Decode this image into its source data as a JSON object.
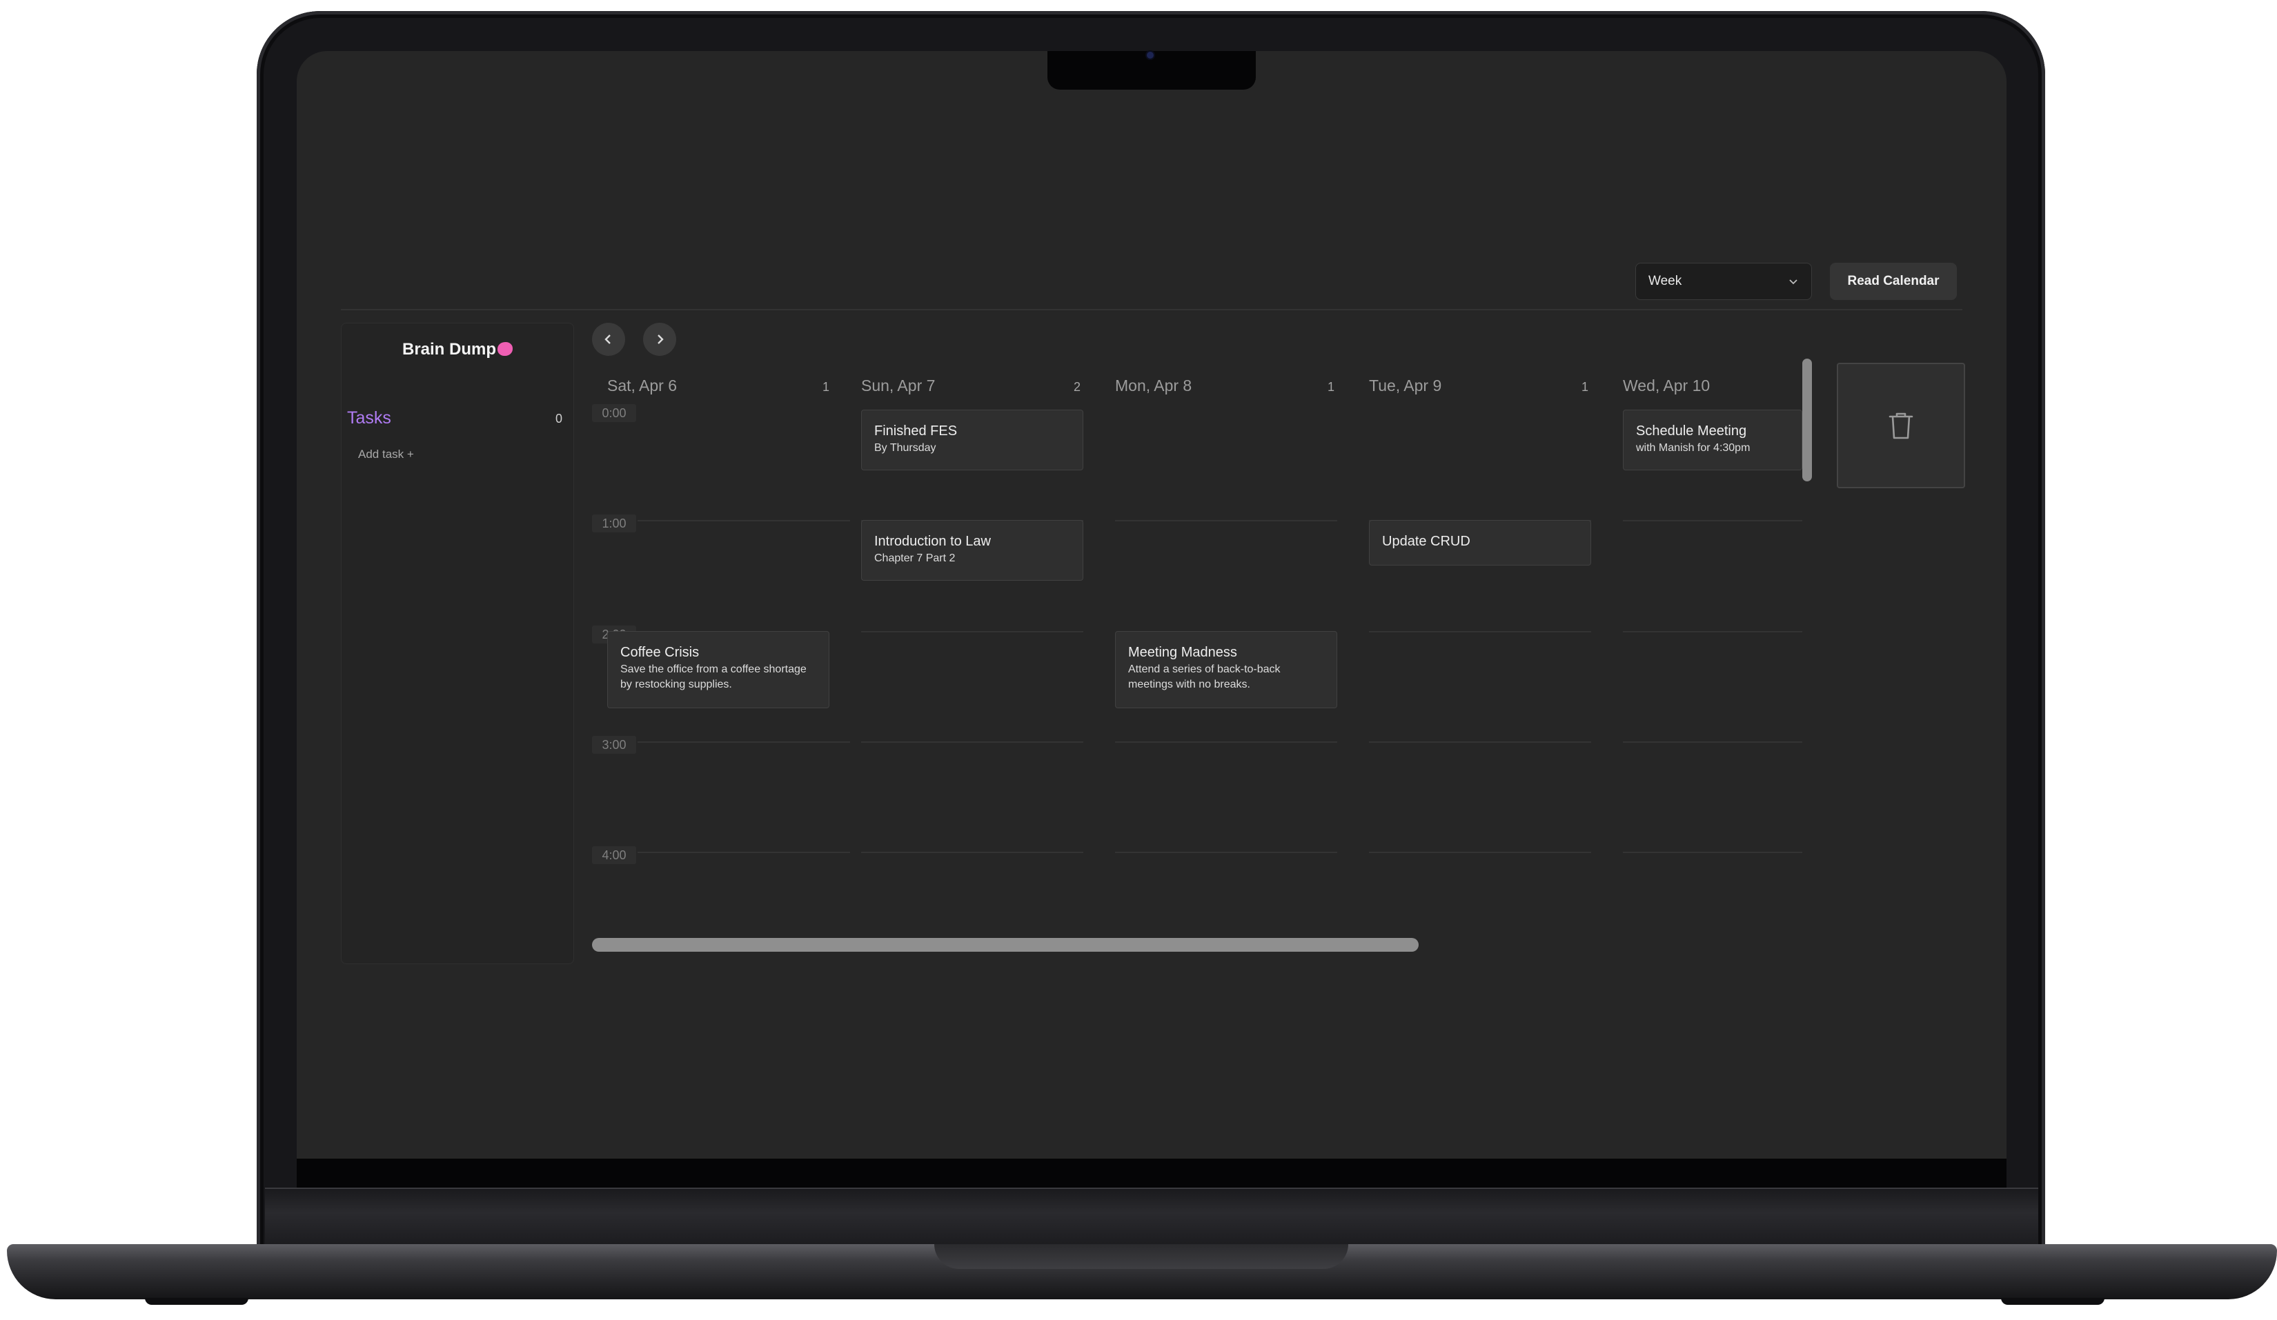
{
  "toolbar": {
    "view_select": {
      "value": "Week",
      "options": [
        "Week"
      ]
    },
    "read_calendar_label": "Read Calendar"
  },
  "sidebar": {
    "title": "Brain Dump",
    "tasks_label": "Tasks",
    "tasks_count": "0",
    "add_task_label": "Add task +"
  },
  "calendar": {
    "days": [
      {
        "label": "Sat, Apr 6",
        "count": "1"
      },
      {
        "label": "Sun, Apr 7",
        "count": "2"
      },
      {
        "label": "Mon, Apr 8",
        "count": "1"
      },
      {
        "label": "Tue, Apr 9",
        "count": "1"
      },
      {
        "label": "Wed, Apr 10",
        "count": ""
      }
    ],
    "times": [
      "0:00",
      "1:00",
      "2:00",
      "3:00",
      "4:00"
    ],
    "events": [
      {
        "title": "Finished FES",
        "subtitle": "By Thursday"
      },
      {
        "title": "Introduction to Law",
        "subtitle": "Chapter 7 Part 2"
      },
      {
        "title": "Coffee Crisis",
        "subtitle": "Save the office from a coffee shortage by restocking supplies."
      },
      {
        "title": "Meeting Madness",
        "subtitle": "Attend a series of back-to-back meetings with no breaks."
      },
      {
        "title": "Update CRUD",
        "subtitle": ""
      },
      {
        "title": "Schedule Meeting",
        "subtitle": "with Manish for 4:30pm"
      }
    ]
  },
  "icons": {
    "prev": "chevron-left-icon",
    "next": "chevron-right-icon",
    "select": "chevron-down-icon",
    "trash": "trash-icon",
    "brain": "brain-icon"
  },
  "colors": {
    "tasks_accent": "#b07cf4",
    "brain_accent": "#ef5fb3",
    "screen_bg": "#262626"
  }
}
